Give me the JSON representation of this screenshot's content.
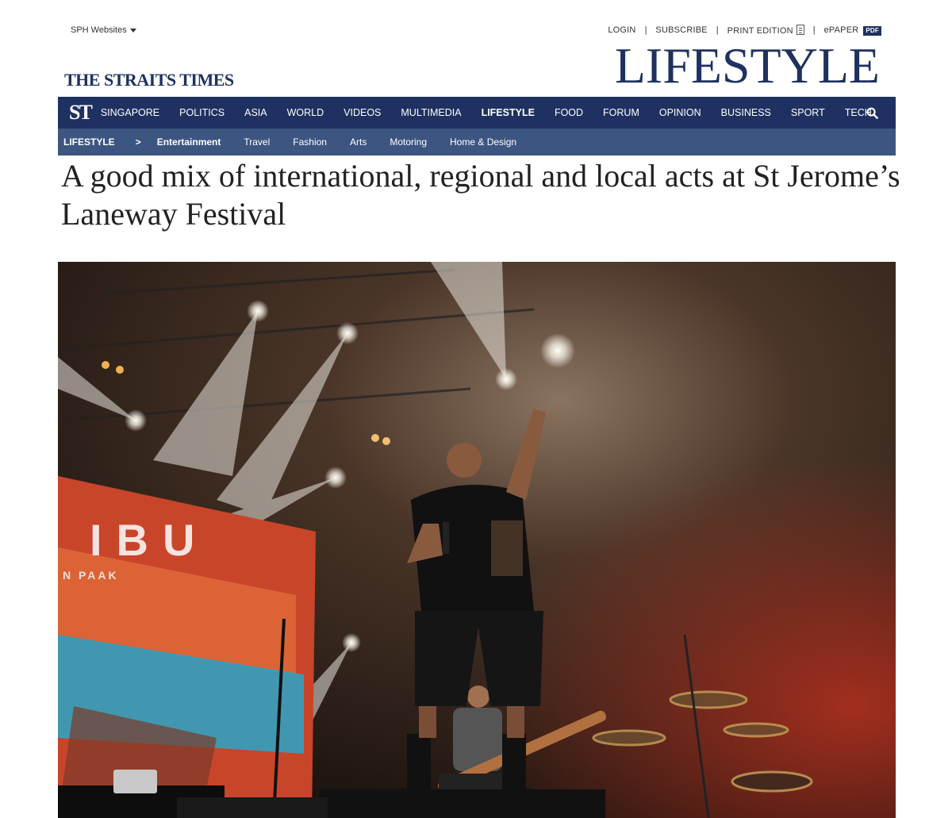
{
  "topbar": {
    "sph_websites": "SPH Websites",
    "links": {
      "login": "LOGIN",
      "subscribe": "SUBSCRIBE",
      "print_edition": "PRINT EDITION",
      "epaper": "ePAPER",
      "pdf_badge": "PDF"
    },
    "separator": "|"
  },
  "masthead": {
    "logo": "THE STRAITS TIMES",
    "section_title": "LIFESTYLE",
    "brand_color": "#1e3160"
  },
  "nav": {
    "mini_logo": "ST",
    "items": [
      "SINGAPORE",
      "POLITICS",
      "ASIA",
      "WORLD",
      "VIDEOS",
      "MULTIMEDIA",
      "LIFESTYLE",
      "FOOD",
      "FORUM",
      "OPINION",
      "BUSINESS",
      "SPORT",
      "TECH"
    ],
    "active": "LIFESTYLE",
    "search_icon": "search-icon"
  },
  "subnav": {
    "root": "LIFESTYLE",
    "chevron": ">",
    "items": [
      "Entertainment",
      "Travel",
      "Fashion",
      "Arts",
      "Motoring",
      "Home & Design"
    ],
    "active": "Entertainment",
    "bar_color": "#3d5581"
  },
  "article": {
    "headline": "A good mix of international, regional and local acts at St Jerome’s Laneway Festival",
    "hero_image": {
      "screen_text_1": "IBU",
      "screen_text_2": "N PAAK"
    }
  }
}
